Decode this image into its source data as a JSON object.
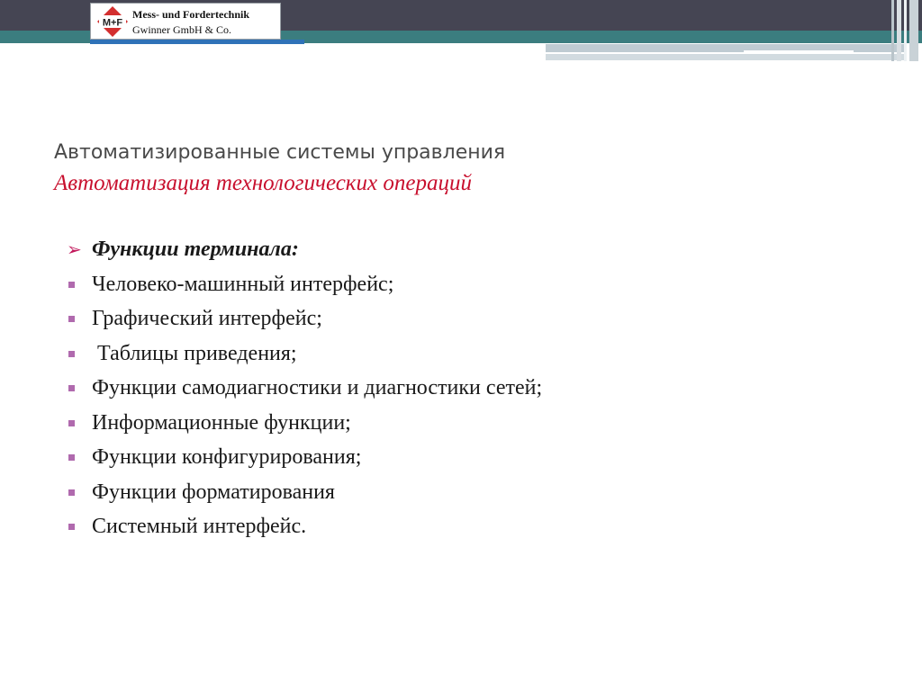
{
  "logo": {
    "mark_text": "M+F",
    "company_line1": "Mess- und Fordertechnik",
    "company_line2": "Gwinner GmbH & Co."
  },
  "slide": {
    "title": "Автоматизированные системы управления",
    "subtitle": "Автоматизация технологических операций",
    "heading": "Функции терминала:",
    "items": [
      "Человеко-машинный интерфейс;",
      "Графический интерфейс;",
      " Таблицы приведения;",
      "Функции самодиагностики и диагностики сетей;",
      "Информационные функции;",
      "Функции конфигурирования;",
      "Функции форматирования",
      "Системный интерфейс."
    ]
  },
  "colors": {
    "header_dark": "#454553",
    "header_teal": "#3b7d7f",
    "accent_blue": "#2f72b8",
    "subtitle_red": "#c8102e",
    "bullet_purple": "#b06aae",
    "arrow_magenta": "#c2185b"
  },
  "icons": {
    "heading_bullet": "arrow-bullet-icon",
    "item_bullet": "square-bullet-icon"
  }
}
